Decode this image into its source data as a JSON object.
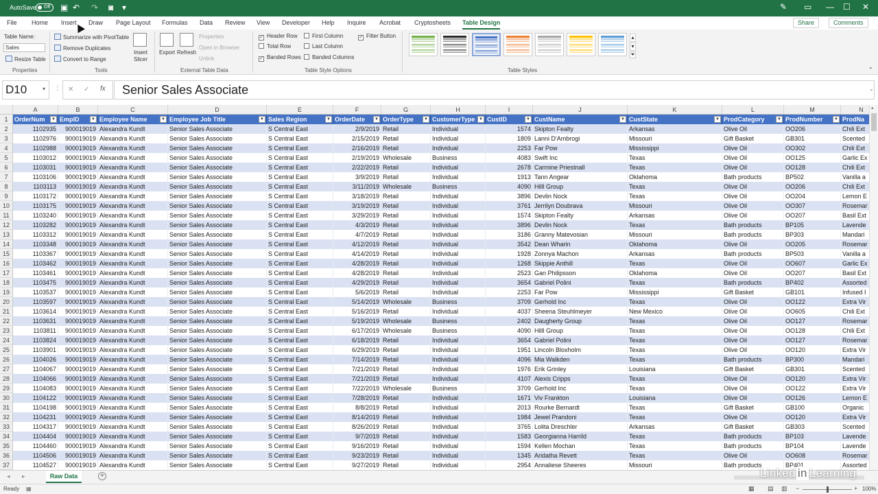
{
  "titlebar": {
    "autosave_label": "AutoSave",
    "autosave_state": "Off"
  },
  "tabs": [
    "File",
    "Home",
    "Insert",
    "Draw",
    "Page Layout",
    "Formulas",
    "Data",
    "Review",
    "View",
    "Developer",
    "Help",
    "Inquire",
    "Acrobat",
    "Cryptosheets",
    "Table Design"
  ],
  "active_tab": "Table Design",
  "share_label": "Share",
  "comments_label": "Comments",
  "ribbon": {
    "table_name_label": "Table Name:",
    "table_name_value": "Sales",
    "resize_table": "Resize Table",
    "properties_group": "Properties",
    "summarize_pivot": "Summarize with PivotTable",
    "remove_duplicates": "Remove Duplicates",
    "convert_to_range": "Convert to Range",
    "insert_slicer_1": "Insert",
    "insert_slicer_2": "Slicer",
    "tools_group": "Tools",
    "export": "Export",
    "refresh": "Refresh",
    "properties_btn": "Properties",
    "open_in_browser": "Open in Browser",
    "unlink": "Unlink",
    "external_group": "External Table Data",
    "header_row": "Header Row",
    "total_row": "Total Row",
    "banded_rows": "Banded Rows",
    "first_column": "First Column",
    "last_column": "Last Column",
    "banded_columns": "Banded Columns",
    "filter_button": "Filter Button",
    "style_options_group": "Table Style Options",
    "table_styles_group": "Table Styles",
    "options_checked": {
      "header_row": true,
      "total_row": false,
      "banded_rows": true,
      "first_column": false,
      "last_column": false,
      "banded_columns": false,
      "filter_button": true
    },
    "style_colors": [
      "#70ad47",
      "#262626",
      "#4472c4",
      "#ed7d31",
      "#a5a5a5",
      "#ffc000",
      "#5b9bd5"
    ]
  },
  "formula_bar": {
    "name_box": "D10",
    "formula": "Senior Sales Associate",
    "fx": "fx"
  },
  "columns": [
    {
      "letter": "A",
      "header": "OrderNum",
      "num": true
    },
    {
      "letter": "B",
      "header": "EmpID",
      "num": true
    },
    {
      "letter": "C",
      "header": "Employee Name",
      "num": false
    },
    {
      "letter": "D",
      "header": "Employee Job Title",
      "num": false
    },
    {
      "letter": "E",
      "header": "Sales Region",
      "num": false
    },
    {
      "letter": "F",
      "header": "OrderDate",
      "num": true
    },
    {
      "letter": "G",
      "header": "OrderType",
      "num": false
    },
    {
      "letter": "H",
      "header": "CustomerType",
      "num": false
    },
    {
      "letter": "I",
      "header": "CustID",
      "num": true
    },
    {
      "letter": "J",
      "header": "CustName",
      "num": false
    },
    {
      "letter": "K",
      "header": "CustState",
      "num": false
    },
    {
      "letter": "L",
      "header": "ProdCategory",
      "num": false
    },
    {
      "letter": "M",
      "header": "ProdNumber",
      "num": false
    },
    {
      "letter": "N",
      "header": "ProdNa",
      "num": false
    }
  ],
  "rows": [
    [
      "1102935",
      "900019019",
      "Alexandra Kundt",
      "Senior Sales Associate",
      "S Central East",
      "2/9/2019",
      "Retail",
      "Individual",
      "1574",
      "Skipton Fealty",
      "Arkansas",
      "Olive Oil",
      "OO206",
      "Chili Ext"
    ],
    [
      "1102976",
      "900019019",
      "Alexandra Kundt",
      "Senior Sales Associate",
      "S Central East",
      "2/15/2019",
      "Retail",
      "Individual",
      "1809",
      "Lanni D'Ambrogi",
      "Missouri",
      "Gift Basket",
      "GB301",
      "Scented"
    ],
    [
      "1102988",
      "900019019",
      "Alexandra Kundt",
      "Senior Sales Associate",
      "S Central East",
      "2/16/2019",
      "Retail",
      "Individual",
      "2253",
      "Far Pow",
      "Mississippi",
      "Olive Oil",
      "OO302",
      "Chili Ext"
    ],
    [
      "1103012",
      "900019019",
      "Alexandra Kundt",
      "Senior Sales Associate",
      "S Central East",
      "2/19/2019",
      "Wholesale",
      "Business",
      "4083",
      "Swift Inc",
      "Texas",
      "Olive Oil",
      "OO125",
      "Garlic Ex"
    ],
    [
      "1103031",
      "900019019",
      "Alexandra Kundt",
      "Senior Sales Associate",
      "S Central East",
      "2/22/2019",
      "Retail",
      "Individual",
      "2678",
      "Carmine Priestnall",
      "Texas",
      "Olive Oil",
      "OO128",
      "Chili Ext"
    ],
    [
      "1103106",
      "900019019",
      "Alexandra Kundt",
      "Senior Sales Associate",
      "S Central East",
      "3/9/2019",
      "Retail",
      "Individual",
      "1913",
      "Tann Angear",
      "Oklahoma",
      "Bath products",
      "BP502",
      "Vanilla a"
    ],
    [
      "1103113",
      "900019019",
      "Alexandra Kundt",
      "Senior Sales Associate",
      "S Central East",
      "3/11/2019",
      "Wholesale",
      "Business",
      "4090",
      "Hilll Group",
      "Texas",
      "Olive Oil",
      "OO206",
      "Chili Ext"
    ],
    [
      "1103172",
      "900019019",
      "Alexandra Kundt",
      "Senior Sales Associate",
      "S Central East",
      "3/18/2019",
      "Retail",
      "Individual",
      "3896",
      "Devlin Nock",
      "Texas",
      "Olive Oil",
      "OO204",
      "Lemon E"
    ],
    [
      "1103175",
      "900019019",
      "Alexandra Kundt",
      "Senior Sales Associate",
      "S Central East",
      "3/19/2019",
      "Retail",
      "Individual",
      "3761",
      "Jerrilyn Doubrava",
      "Missouri",
      "Olive Oil",
      "OO307",
      "Rosemar"
    ],
    [
      "1103240",
      "900019019",
      "Alexandra Kundt",
      "Senior Sales Associate",
      "S Central East",
      "3/29/2019",
      "Retail",
      "Individual",
      "1574",
      "Skipton Fealty",
      "Arkansas",
      "Olive Oil",
      "OO207",
      "Basil Ext"
    ],
    [
      "1103282",
      "900019019",
      "Alexandra Kundt",
      "Senior Sales Associate",
      "S Central East",
      "4/3/2019",
      "Retail",
      "Individual",
      "3896",
      "Devlin Nock",
      "Texas",
      "Bath products",
      "BP105",
      "Lavende"
    ],
    [
      "1103312",
      "900019019",
      "Alexandra Kundt",
      "Senior Sales Associate",
      "S Central East",
      "4/7/2019",
      "Retail",
      "Individual",
      "3186",
      "Granny Matevosian",
      "Missouri",
      "Bath products",
      "BP303",
      "Mandari"
    ],
    [
      "1103348",
      "900019019",
      "Alexandra Kundt",
      "Senior Sales Associate",
      "S Central East",
      "4/12/2019",
      "Retail",
      "Individual",
      "3542",
      "Dean Wharin",
      "Oklahoma",
      "Olive Oil",
      "OO205",
      "Rosemar"
    ],
    [
      "1103367",
      "900019019",
      "Alexandra Kundt",
      "Senior Sales Associate",
      "S Central East",
      "4/14/2019",
      "Retail",
      "Individual",
      "1928",
      "Zonnya Machon",
      "Arkansas",
      "Bath products",
      "BP503",
      "Vanilla a"
    ],
    [
      "1103462",
      "900019019",
      "Alexandra Kundt",
      "Senior Sales Associate",
      "S Central East",
      "4/28/2019",
      "Retail",
      "Individual",
      "1268",
      "Skippie Anthill",
      "Texas",
      "Olive Oil",
      "OO607",
      "Garlic Ex"
    ],
    [
      "1103461",
      "900019019",
      "Alexandra Kundt",
      "Senior Sales Associate",
      "S Central East",
      "4/28/2019",
      "Retail",
      "Individual",
      "2523",
      "Gan Philipsson",
      "Oklahoma",
      "Olive Oil",
      "OO207",
      "Basil Ext"
    ],
    [
      "1103475",
      "900019019",
      "Alexandra Kundt",
      "Senior Sales Associate",
      "S Central East",
      "4/29/2019",
      "Retail",
      "Individual",
      "3654",
      "Gabriel Polini",
      "Texas",
      "Bath products",
      "BP402",
      "Assorted"
    ],
    [
      "1103537",
      "900019019",
      "Alexandra Kundt",
      "Senior Sales Associate",
      "S Central East",
      "5/6/2019",
      "Retail",
      "Individual",
      "2253",
      "Far Pow",
      "Mississippi",
      "Gift Basket",
      "GB101",
      "Infused I"
    ],
    [
      "1103597",
      "900019019",
      "Alexandra Kundt",
      "Senior Sales Associate",
      "S Central East",
      "5/14/2019",
      "Wholesale",
      "Business",
      "3709",
      "Gerhold Inc",
      "Texas",
      "Olive Oil",
      "OO122",
      "Extra Vir"
    ],
    [
      "1103614",
      "900019019",
      "Alexandra Kundt",
      "Senior Sales Associate",
      "S Central East",
      "5/16/2019",
      "Retail",
      "Individual",
      "4037",
      "Sheena Steuhlmeyer",
      "New Mexico",
      "Olive Oil",
      "OO605",
      "Chili Ext"
    ],
    [
      "1103631",
      "900019019",
      "Alexandra Kundt",
      "Senior Sales Associate",
      "S Central East",
      "5/19/2019",
      "Wholesale",
      "Business",
      "2402",
      "Daugherty Group",
      "Texas",
      "Olive Oil",
      "OO127",
      "Rosemar"
    ],
    [
      "1103811",
      "900019019",
      "Alexandra Kundt",
      "Senior Sales Associate",
      "S Central East",
      "6/17/2019",
      "Wholesale",
      "Business",
      "4090",
      "Hilll Group",
      "Texas",
      "Olive Oil",
      "OO128",
      "Chili Ext"
    ],
    [
      "1103824",
      "900019019",
      "Alexandra Kundt",
      "Senior Sales Associate",
      "S Central East",
      "6/18/2019",
      "Retail",
      "Individual",
      "3654",
      "Gabriel Polini",
      "Texas",
      "Olive Oil",
      "OO127",
      "Rosemar"
    ],
    [
      "1103901",
      "900019019",
      "Alexandra Kundt",
      "Senior Sales Associate",
      "S Central East",
      "6/29/2019",
      "Retail",
      "Individual",
      "1951",
      "Lincoln Bloxholm",
      "Texas",
      "Olive Oil",
      "OO120",
      "Extra Vir"
    ],
    [
      "1104026",
      "900019019",
      "Alexandra Kundt",
      "Senior Sales Associate",
      "S Central East",
      "7/14/2019",
      "Retail",
      "Individual",
      "4096",
      "Mia Walkden",
      "Texas",
      "Bath products",
      "BP300",
      "Mandari"
    ],
    [
      "1104067",
      "900019019",
      "Alexandra Kundt",
      "Senior Sales Associate",
      "S Central East",
      "7/21/2019",
      "Retail",
      "Individual",
      "1976",
      "Erik Grinley",
      "Louisiana",
      "Gift Basket",
      "GB301",
      "Scented"
    ],
    [
      "1104066",
      "900019019",
      "Alexandra Kundt",
      "Senior Sales Associate",
      "S Central East",
      "7/21/2019",
      "Retail",
      "Individual",
      "4107",
      "Alexis Cripps",
      "Texas",
      "Olive Oil",
      "OO120",
      "Extra Vir"
    ],
    [
      "1104083",
      "900019019",
      "Alexandra Kundt",
      "Senior Sales Associate",
      "S Central East",
      "7/22/2019",
      "Wholesale",
      "Business",
      "3709",
      "Gerhold Inc",
      "Texas",
      "Olive Oil",
      "OO122",
      "Extra Vir"
    ],
    [
      "1104122",
      "900019019",
      "Alexandra Kundt",
      "Senior Sales Associate",
      "S Central East",
      "7/28/2019",
      "Retail",
      "Individual",
      "1671",
      "Viv Frankton",
      "Louisiana",
      "Olive Oil",
      "OO126",
      "Lemon E"
    ],
    [
      "1104198",
      "900019019",
      "Alexandra Kundt",
      "Senior Sales Associate",
      "S Central East",
      "8/8/2019",
      "Retail",
      "Individual",
      "2013",
      "Rourke Bernardt",
      "Texas",
      "Gift Basket",
      "GB100",
      "Organic"
    ],
    [
      "1104231",
      "900019019",
      "Alexandra Kundt",
      "Senior Sales Associate",
      "S Central East",
      "8/14/2019",
      "Retail",
      "Individual",
      "1984",
      "Jewel Prandoni",
      "Texas",
      "Olive Oil",
      "OO120",
      "Extra Vir"
    ],
    [
      "1104317",
      "900019019",
      "Alexandra Kundt",
      "Senior Sales Associate",
      "S Central East",
      "8/26/2019",
      "Retail",
      "Individual",
      "3765",
      "Lolita Dreschler",
      "Arkansas",
      "Gift Basket",
      "GB303",
      "Scented"
    ],
    [
      "1104404",
      "900019019",
      "Alexandra Kundt",
      "Senior Sales Associate",
      "S Central East",
      "9/7/2019",
      "Retail",
      "Individual",
      "1583",
      "Georgianna Harrild",
      "Texas",
      "Bath products",
      "BP103",
      "Lavende"
    ],
    [
      "1104460",
      "900019019",
      "Alexandra Kundt",
      "Senior Sales Associate",
      "S Central East",
      "9/16/2019",
      "Retail",
      "Individual",
      "1594",
      "Kellen Mochan",
      "Texas",
      "Bath products",
      "BP104",
      "Lavende"
    ],
    [
      "1104506",
      "900019019",
      "Alexandra Kundt",
      "Senior Sales Associate",
      "S Central East",
      "9/23/2019",
      "Retail",
      "Individual",
      "1345",
      "Aridatha Revett",
      "Texas",
      "Olive Oil",
      "OO608",
      "Rosemar"
    ],
    [
      "1104527",
      "900019019",
      "Alexandra Kundt",
      "Senior Sales Associate",
      "S Central East",
      "9/27/2019",
      "Retail",
      "Individual",
      "2954",
      "Annaliese Sheeres",
      "Missouri",
      "Bath products",
      "BP401",
      "Assorted"
    ]
  ],
  "sheet_tab": "Raw Data",
  "status": {
    "ready": "Ready",
    "zoom": "100%"
  },
  "watermark": {
    "pre": "Linked",
    "in": "in",
    "post": "Learning"
  },
  "icons": [
    "save-icon",
    "undo-icon",
    "redo-icon",
    "add-sheet-icon",
    "fx-icon",
    "filter-dropdown-icon"
  ]
}
